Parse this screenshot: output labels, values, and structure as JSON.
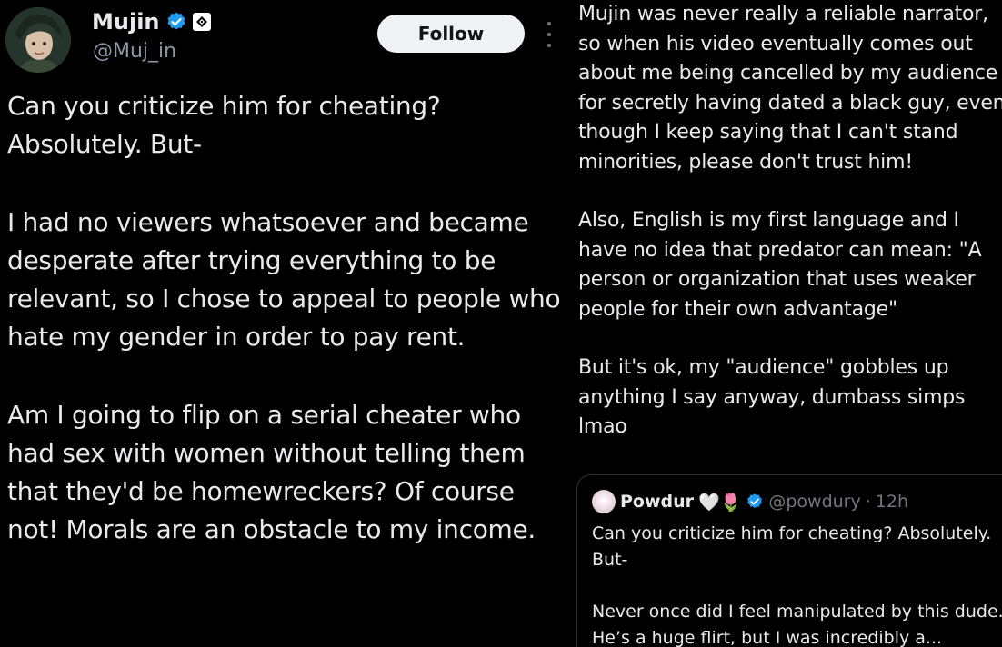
{
  "left_post": {
    "author": {
      "name": "Mujin",
      "handle": "@Muj_in"
    },
    "follow_label": "Follow",
    "paragraphs": [
      "Can you criticize him for cheating? Absolutely. But-",
      "I had no viewers whatsoever and became desperate after trying everything to be relevant, so I chose to appeal to people who hate my gender in order to pay rent.",
      "Am I going to flip on a serial cheater who had sex with women without telling them that they'd be homewreckers? Of course not! Morals are an obstacle to my income."
    ]
  },
  "right_post": {
    "paragraphs": [
      "Mujin was never really a reliable narrator, so when his video eventually comes out about me being cancelled by my audience for secretly having dated a black guy, even though I keep saying that I can't stand minorities, please don't trust him!",
      "Also, English is my first language and I have no idea that predator can mean: \"A person or organization that uses weaker people for their own advantage\"",
      "But it's ok, my \"audience\" gobbles up anything I say anyway, dumbass simps lmao"
    ],
    "quote": {
      "name": "Powdur",
      "emojis": "🤍🌷",
      "handle": "@powdury",
      "separator": "·",
      "time": "12h",
      "paragraphs": [
        "Can you criticize him for cheating? Absolutely. But-",
        "Never once did I feel manipulated by this dude. He’s a huge flirt, but I was incredibly a..."
      ]
    }
  },
  "colors": {
    "background": "#000000",
    "text": "#e7e9ea",
    "secondary_text": "#8b98a5",
    "verified_blue": "#1d9bf0",
    "follow_bg": "#eff3f4",
    "border": "#2f3336"
  },
  "icons": {
    "verified": "verified-badge-icon",
    "affiliation": "affiliation-badge-icon",
    "more": "more-options-icon"
  }
}
